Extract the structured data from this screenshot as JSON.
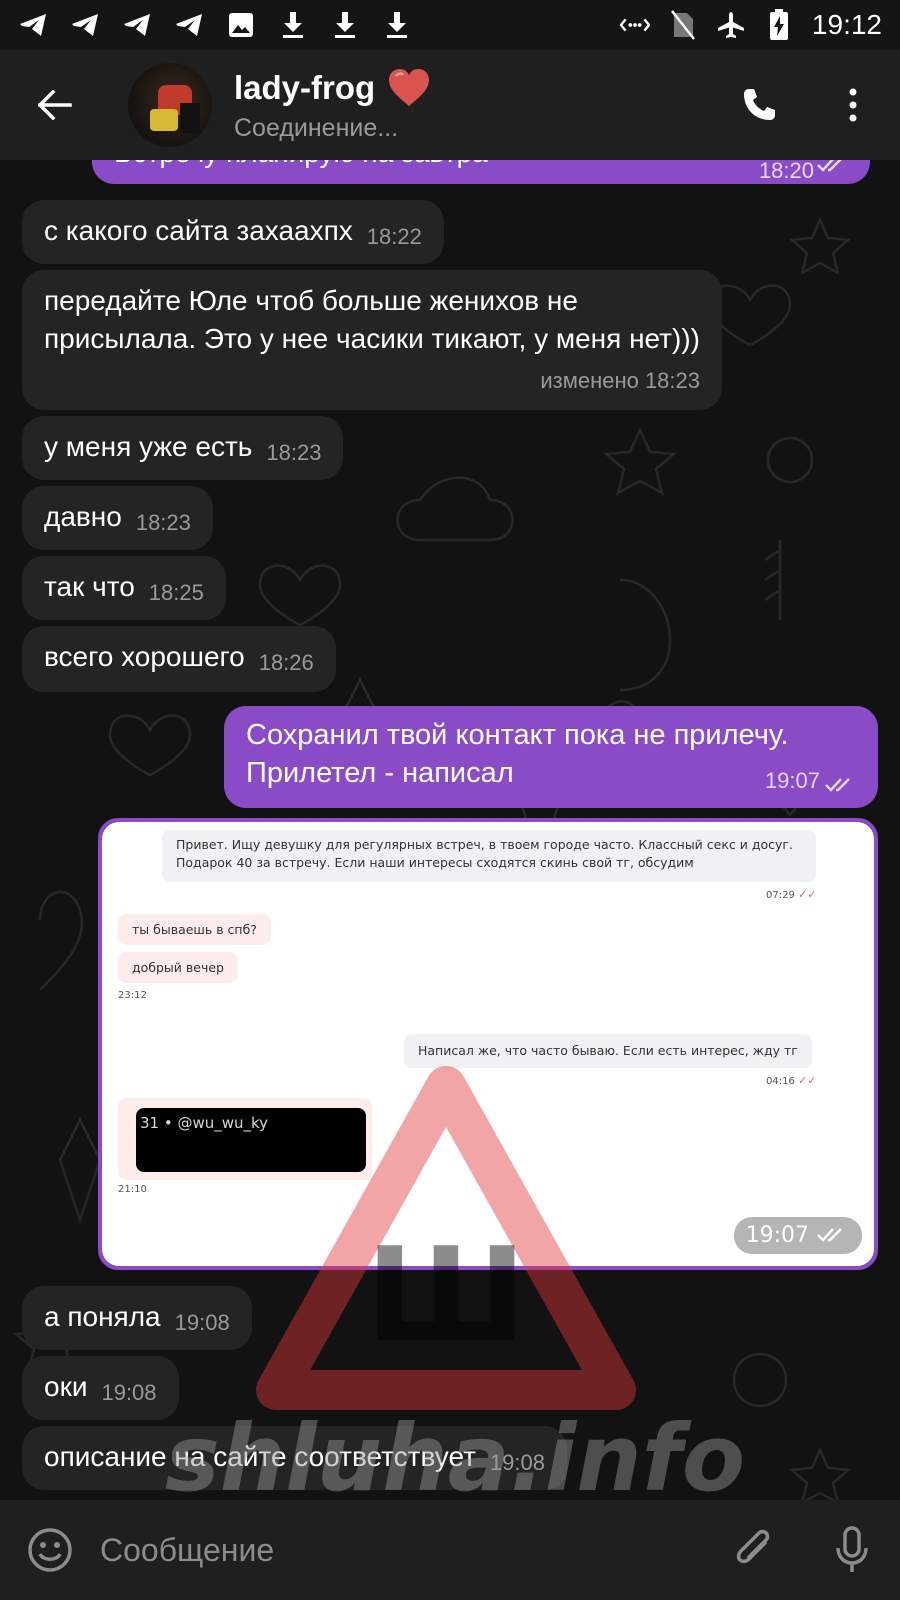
{
  "status_bar": {
    "time": "19:12",
    "left_icons": [
      "telegram-icon",
      "telegram-icon",
      "telegram-icon",
      "telegram-icon",
      "image-icon",
      "download-icon",
      "download-icon",
      "download-icon"
    ],
    "right_icons": [
      "data-sync-icon",
      "no-sim-icon",
      "airplane-icon",
      "battery-charging-icon"
    ]
  },
  "header": {
    "title": "lady-frog",
    "title_emoji": "heart-icon",
    "status": "Соединение...",
    "actions": [
      "phone-icon",
      "more-vert-icon"
    ]
  },
  "messages": [
    {
      "dir": "out",
      "text": "Встречу планирую на завтра",
      "time": "18:20",
      "read": true
    },
    {
      "dir": "in",
      "text": "с какого сайта захаахпх",
      "time": "18:22"
    },
    {
      "dir": "in",
      "text": "передайте Юле чтоб больше женихов не присылала. Это у нее часики тикают, у меня нет)))",
      "time": "изменено 18:23"
    },
    {
      "dir": "in",
      "text": "у меня уже есть",
      "time": "18:23"
    },
    {
      "dir": "in",
      "text": "давно",
      "time": "18:23"
    },
    {
      "dir": "in",
      "text": "так что",
      "time": "18:25"
    },
    {
      "dir": "in",
      "text": "всего хорошего",
      "time": "18:26"
    },
    {
      "dir": "out",
      "text": "Сохранил твой контакт пока не прилечу. Прилетел - написал",
      "time": "19:07",
      "read": true
    },
    {
      "dir": "out",
      "type": "photo",
      "time": "19:07",
      "read": true
    },
    {
      "dir": "in",
      "text": "а поняла",
      "time": "19:08"
    },
    {
      "dir": "in",
      "text": "оки",
      "time": "19:08"
    },
    {
      "dir": "in",
      "text": "описание на сайте соответствует",
      "time": "19:08"
    }
  ],
  "screenshot": {
    "msg1": "Привет. Ищу девушку для регулярных встреч, в твоем городе часто. Классный секс и досуг. Подарок 40 за встречу. Если наши интересы сходятся скинь свой тг, обсудим",
    "msg1_time": "07:29",
    "msg2": "ты бываешь в спб?",
    "msg3": "добрый вечер",
    "msg23_time": "23:12",
    "msg4": "Написал же, что часто бываю. Если есть интерес, жду тг",
    "msg4_time": "04:16",
    "msg5": "31 • @wu_wu_ky",
    "msg5_time": "21:10"
  },
  "watermark": {
    "text": "shluha.info",
    "logo_letter": "Ш",
    "color": "#e0383a"
  },
  "input": {
    "placeholder": "Сообщение",
    "icons": [
      "emoji-icon",
      "attach-icon",
      "mic-icon"
    ]
  },
  "colors": {
    "outgoing": "#8a4bc7",
    "incoming": "#242424",
    "background": "#121212",
    "bar": "#1f1f1f"
  }
}
